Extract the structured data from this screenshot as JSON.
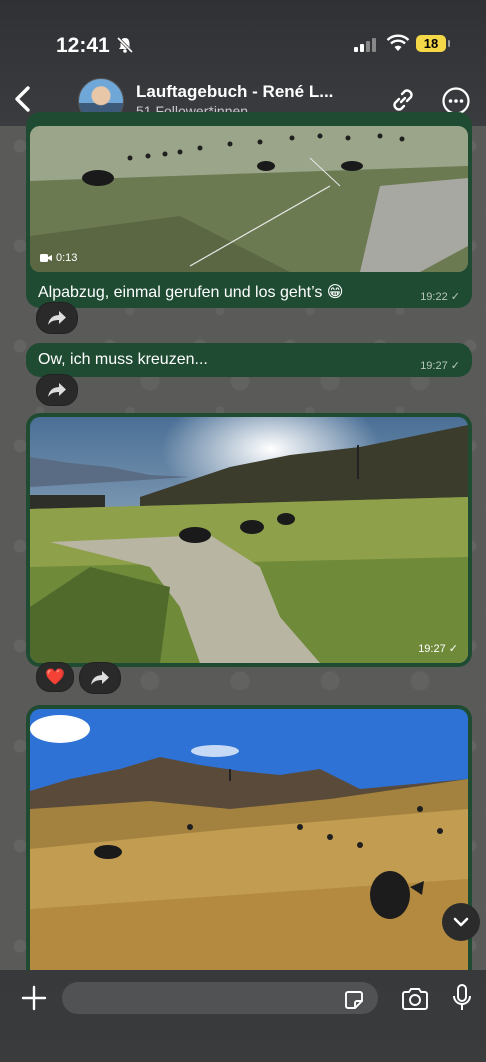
{
  "status_bar": {
    "time": "12:41",
    "battery": "18"
  },
  "header": {
    "title": "Lauftagebuch - René L...",
    "subtitle": "51 Follower*innen"
  },
  "messages": [
    {
      "caption": "Alpabzug, einmal gerufen und los geht’s 😁",
      "time": "19:22 ✓",
      "video_duration": "0:13"
    },
    {
      "text": "Ow, ich muss kreuzen...",
      "time": "19:27 ✓"
    },
    {
      "time": "19:27 ✓",
      "reaction": "❤️"
    }
  ],
  "composer": {
    "placeholder": ""
  },
  "colors": {
    "bubble": "#1e4b32",
    "header": "#2f3134",
    "background": "#5a5a58"
  }
}
